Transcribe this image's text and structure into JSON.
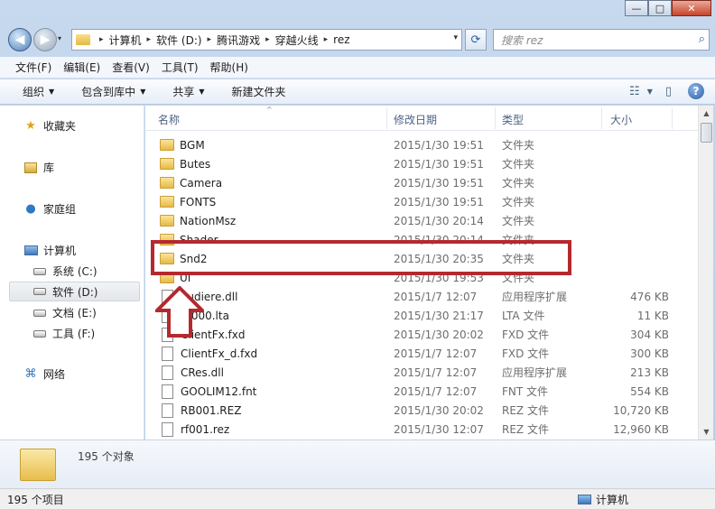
{
  "window": {
    "caption_min": "—",
    "caption_max": "□",
    "caption_close": "✕"
  },
  "nav": {
    "back_glyph": "◀",
    "forward_glyph": "▶",
    "history_glyph": "▾"
  },
  "address": {
    "crumbs": [
      "计算机",
      "软件 (D:)",
      "腾讯游戏",
      "穿越火线",
      "rez"
    ],
    "sep": "▸",
    "drop_glyph": "▾",
    "refresh_glyph": "⟳"
  },
  "search": {
    "placeholder": "搜索 rez",
    "icon": "search-icon"
  },
  "menu": [
    "文件(F)",
    "编辑(E)",
    "查看(V)",
    "工具(T)",
    "帮助(H)"
  ],
  "toolbar": {
    "organize": "组织",
    "include_library": "包含到库中",
    "share": "共享",
    "new_folder": "新建文件夹",
    "dropdown_glyph": "▼",
    "view_glyph": "☷",
    "preview_glyph": "▯",
    "help_glyph": "?"
  },
  "sidebar": {
    "favorites": "收藏夹",
    "libraries": "库",
    "homegroup": "家庭组",
    "computer": "计算机",
    "drives": [
      "系统 (C:)",
      "软件 (D:)",
      "文档 (E:)",
      "工具 (F:)"
    ],
    "network": "网络"
  },
  "columns": {
    "name": "名称",
    "date": "修改日期",
    "type": "类型",
    "size": "大小",
    "sort_glyph": "^"
  },
  "files": [
    {
      "name": "BGM",
      "date": "2015/1/30 19:51",
      "type": "文件夹",
      "size": "",
      "kind": "folder"
    },
    {
      "name": "Butes",
      "date": "2015/1/30 19:51",
      "type": "文件夹",
      "size": "",
      "kind": "folder"
    },
    {
      "name": "Camera",
      "date": "2015/1/30 19:51",
      "type": "文件夹",
      "size": "",
      "kind": "folder"
    },
    {
      "name": "FONTS",
      "date": "2015/1/30 19:51",
      "type": "文件夹",
      "size": "",
      "kind": "folder"
    },
    {
      "name": "NationMsz",
      "date": "2015/1/30 20:14",
      "type": "文件夹",
      "size": "",
      "kind": "folder"
    },
    {
      "name": "Shader",
      "date": "2015/1/30 20:14",
      "type": "文件夹",
      "size": "",
      "kind": "folder"
    },
    {
      "name": "Snd2",
      "date": "2015/1/30 20:35",
      "type": "文件夹",
      "size": "",
      "kind": "folder"
    },
    {
      "name": "UI",
      "date": "2015/1/30 19:53",
      "type": "文件夹",
      "size": "",
      "kind": "folder"
    },
    {
      "name": "audiere.dll",
      "date": "2015/1/7 12:07",
      "type": "应用程序扩展",
      "size": "476 KB",
      "kind": "dll"
    },
    {
      "name": "bf000.lta",
      "date": "2015/1/30 21:17",
      "type": "LTA 文件",
      "size": "11 KB",
      "kind": "file"
    },
    {
      "name": "ClientFx.fxd",
      "date": "2015/1/30 20:02",
      "type": "FXD 文件",
      "size": "304 KB",
      "kind": "file"
    },
    {
      "name": "ClientFx_d.fxd",
      "date": "2015/1/7 12:07",
      "type": "FXD 文件",
      "size": "300 KB",
      "kind": "file"
    },
    {
      "name": "CRes.dll",
      "date": "2015/1/7 12:07",
      "type": "应用程序扩展",
      "size": "213 KB",
      "kind": "dll"
    },
    {
      "name": "GOOLIM12.fnt",
      "date": "2015/1/7 12:07",
      "type": "FNT 文件",
      "size": "554 KB",
      "kind": "file"
    },
    {
      "name": "RB001.REZ",
      "date": "2015/1/30 20:02",
      "type": "REZ 文件",
      "size": "10,720 KB",
      "kind": "file"
    },
    {
      "name": "rf001.rez",
      "date": "2015/1/30 12:07",
      "type": "REZ 文件",
      "size": "12,960 KB",
      "kind": "file"
    }
  ],
  "details": {
    "count": "195 个对象"
  },
  "status": {
    "items": "195 个项目",
    "location": "计算机"
  },
  "scroll": {
    "up": "▲",
    "down": "▼"
  }
}
